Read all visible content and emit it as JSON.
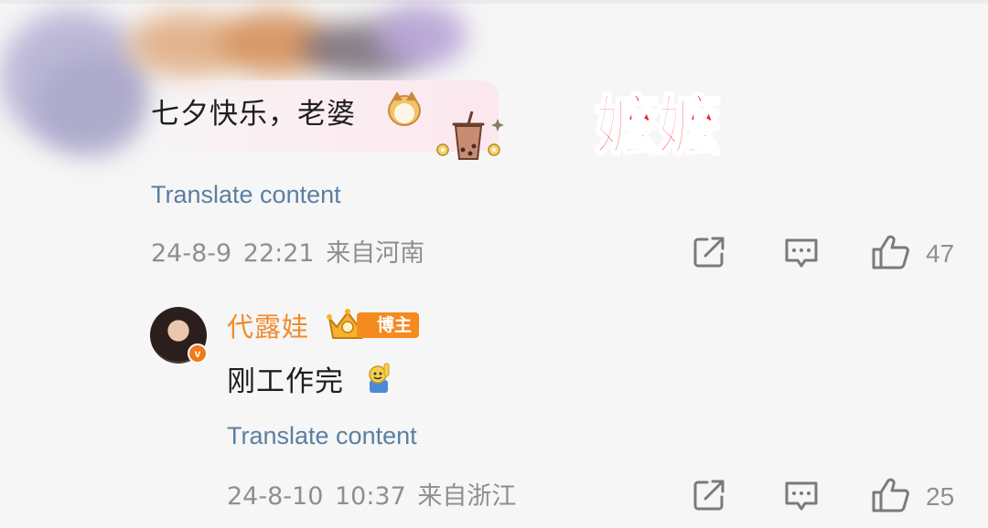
{
  "overlay_label": "嬷嬷",
  "comment": {
    "text": "七夕快乐，老婆",
    "translate_label": "Translate content",
    "timestamp": "24-8-9 22:21",
    "location": "来自河南",
    "like_count": "47"
  },
  "reply": {
    "author": "代露娃",
    "badge": "博主",
    "verified_mark": "v",
    "text": "刚工作完",
    "translate_label": "Translate content",
    "timestamp": "24-8-10 10:37",
    "location": "来自浙江",
    "like_count": "25"
  },
  "icons": [
    "share-icon",
    "comment-icon",
    "like-icon",
    "crown-icon",
    "cat-emoji-icon",
    "milk-tea-sticker-icon",
    "hand-up-emoji-icon"
  ],
  "colors": {
    "link": "#5a7fa3",
    "meta": "#8f8f8f",
    "author": "#f08a2d",
    "badge": "#f58a1f",
    "label_red": "#f2202a"
  }
}
